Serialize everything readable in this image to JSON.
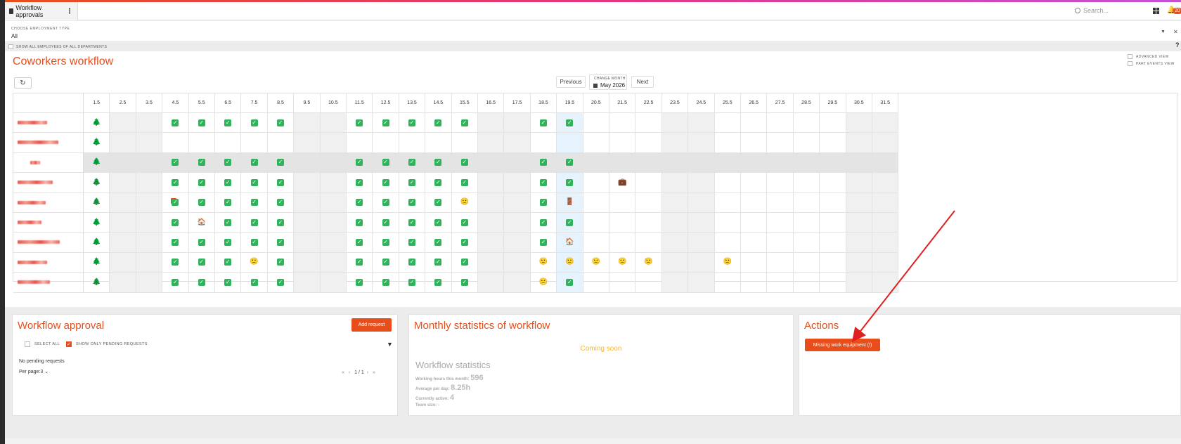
{
  "topbar": {
    "tab_title": "Workflow approvals",
    "search_placeholder": "Search...",
    "notification_count": "20"
  },
  "filter": {
    "label": "CHOOSE EMPLOYMENT TYPE",
    "value": "All",
    "show_all_label": "SHOW ALL EMPLOYEES OF ALL DEPARTMENTS"
  },
  "workflow": {
    "title": "Coworkers workflow",
    "advanced_view": "ADVANCED VIEW",
    "part_events_view": "PART EVENTS VIEW",
    "previous": "Previous",
    "next": "Next",
    "change_month_label": "CHANGE MONTH",
    "month": "May 2026",
    "days": [
      "1.5",
      "2.5",
      "3.5",
      "4.5",
      "5.5",
      "6.5",
      "7.5",
      "8.5",
      "9.5",
      "10.5",
      "11.5",
      "12.5",
      "13.5",
      "14.5",
      "15.5",
      "16.5",
      "17.5",
      "18.5",
      "19.5",
      "20.5",
      "21.5",
      "22.5",
      "23.5",
      "24.5",
      "25.5",
      "26.5",
      "27.5",
      "28.5",
      "29.5",
      "30.5",
      "31.5"
    ],
    "weekend_days": [
      "2.5",
      "3.5",
      "9.5",
      "10.5",
      "16.5",
      "17.5",
      "23.5",
      "24.5",
      "30.5",
      "31.5"
    ],
    "today": "19.5",
    "rows": [
      {
        "status": [
          "tree",
          "",
          "",
          "check",
          "check",
          "check",
          "check",
          "check",
          "",
          "",
          "check",
          "check",
          "check",
          "check",
          "check",
          "",
          "",
          "check",
          "check",
          "",
          "",
          "",
          "",
          "",
          "",
          "",
          "",
          "",
          "",
          "",
          ""
        ]
      },
      {
        "status": [
          "tree",
          "",
          "",
          "",
          "",
          "",
          "",
          "",
          "",
          "",
          "",
          "",
          "",
          "",
          "",
          "",
          "",
          "",
          "",
          "",
          "",
          "",
          "",
          "",
          "",
          "",
          "",
          "",
          "",
          "",
          ""
        ]
      },
      {
        "status": [
          "tree",
          "",
          "",
          "check",
          "check",
          "check",
          "check",
          "check",
          "",
          "",
          "check",
          "check",
          "check",
          "check",
          "check",
          "",
          "",
          "check",
          "check",
          "",
          "",
          "",
          "",
          "",
          "",
          "",
          "",
          "",
          "",
          "",
          ""
        ],
        "inactive": true
      },
      {
        "status": [
          "tree",
          "",
          "",
          "check",
          "check",
          "check",
          "check",
          "check",
          "",
          "",
          "check",
          "check",
          "check",
          "check",
          "check",
          "",
          "",
          "check",
          "check",
          "",
          "briefcase",
          "",
          "",
          "",
          "",
          "",
          "",
          "",
          "",
          "",
          ""
        ]
      },
      {
        "status": [
          "tree",
          "",
          "",
          "check-flag",
          "check",
          "check",
          "check",
          "check",
          "",
          "",
          "check",
          "check",
          "check",
          "check",
          "sick",
          "",
          "",
          "check",
          "door",
          "",
          "",
          "",
          "",
          "",
          "",
          "",
          "",
          "",
          "",
          "",
          ""
        ]
      },
      {
        "status": [
          "tree",
          "",
          "",
          "check",
          "home",
          "check",
          "check",
          "check",
          "",
          "",
          "check",
          "check",
          "check",
          "check",
          "check",
          "",
          "",
          "check",
          "check",
          "",
          "",
          "",
          "",
          "",
          "",
          "",
          "",
          "",
          "",
          "",
          ""
        ]
      },
      {
        "status": [
          "tree",
          "",
          "",
          "check",
          "check",
          "check",
          "check",
          "check",
          "",
          "",
          "check",
          "check",
          "check",
          "check",
          "check",
          "",
          "",
          "check",
          "home",
          "",
          "",
          "",
          "",
          "",
          "",
          "",
          "",
          "",
          "",
          "",
          ""
        ]
      },
      {
        "status": [
          "tree",
          "",
          "",
          "check",
          "check",
          "check",
          "sick",
          "check",
          "",
          "",
          "check",
          "check",
          "check",
          "check",
          "check",
          "",
          "",
          "sick",
          "sick",
          "sick",
          "sick",
          "sick",
          "",
          "",
          "sick",
          "",
          "",
          "",
          "",
          "",
          ""
        ]
      },
      {
        "status": [
          "tree",
          "",
          "",
          "check",
          "check",
          "check",
          "check",
          "check",
          "",
          "",
          "check",
          "check",
          "check",
          "check",
          "check",
          "",
          "",
          "sick",
          "check",
          "",
          "",
          "",
          "",
          "",
          "",
          "",
          "",
          "",
          "",
          "",
          ""
        ]
      }
    ]
  },
  "approval": {
    "title": "Workflow approval",
    "add_request": "Add request",
    "select_all": "SELECT ALL",
    "show_pending": "SHOW ONLY PENDING REQUESTS",
    "empty": "No pending requests",
    "per_page": "Per page:3",
    "page": "1 / 1"
  },
  "stats": {
    "title": "Monthly statistics of workflow",
    "coming_soon": "Coming soon",
    "heading": "Workflow statistics",
    "working_hours_label": "Working hours this month:",
    "working_hours_value": "596",
    "avg_label": "Average per day:",
    "avg_value": "8.25h",
    "active_label": "Currently active:",
    "active_value": "4",
    "team_label": "Team size:",
    "team_value": "-"
  },
  "actions": {
    "title": "Actions",
    "missing_button": "Missing work equipment (!)"
  },
  "colors": {
    "accent": "#e84e1b",
    "check": "#30b35a",
    "weekend": "#f0f0f0",
    "today": "#e6f2fc",
    "inactive_row": "#e4e4e4",
    "arrow": "#e02020"
  }
}
